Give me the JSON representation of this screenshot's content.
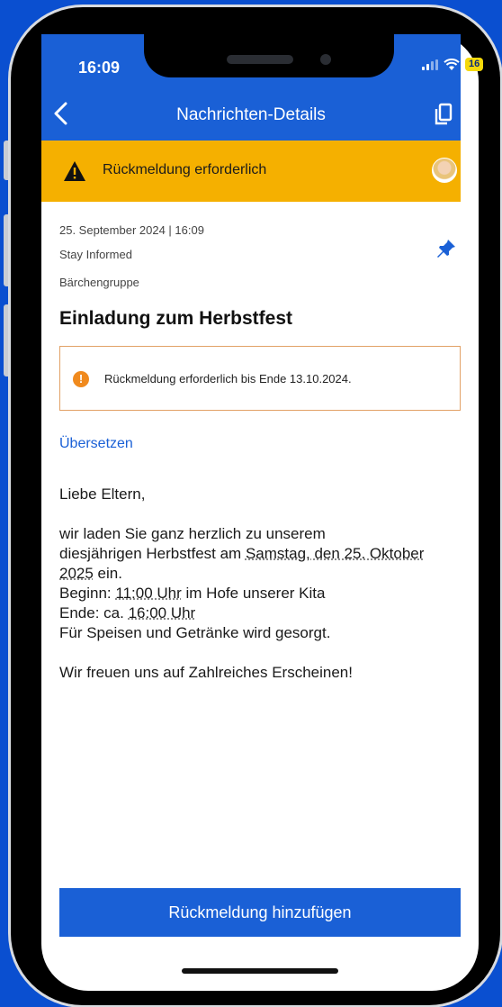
{
  "status_bar": {
    "time": "16:09",
    "battery": "16"
  },
  "header": {
    "title": "Nachrichten-Details"
  },
  "banner": {
    "label": "Rückmeldung erforderlich"
  },
  "message": {
    "date": "25. September 2024 | 16:09",
    "sender": "Stay Informed",
    "group": "Bärchengruppe",
    "title": "Einladung zum Herbstfest",
    "notice": "Rückmeldung erforderlich bis Ende 13.10.2024.",
    "translate_link": "Übersetzen",
    "greeting": "Liebe Eltern,",
    "p1_a": "wir laden Sie ganz herzlich zu unserem",
    "p1_b": "diesjährigen Herbstfest am ",
    "p1_date": "Samstag, den 25. Oktober 2025",
    "p1_c": " ein.",
    "p1_begin_label": "Beginn: ",
    "p1_begin_time": "11:00 Uhr",
    "p1_begin_rest": " im Hofe unserer Kita",
    "p1_end_label": "Ende: ca. ",
    "p1_end_time": "16:00 Uhr",
    "p1_food": "Für Speisen und Getränke wird gesorgt.",
    "closing": "Wir freuen uns auf Zahlreiches Erscheinen!"
  },
  "actions": {
    "add_feedback": "Rückmeldung hinzufügen"
  },
  "colors": {
    "brand": "#1a60d6",
    "banner": "#f5b000",
    "notice_border": "#e2a166",
    "notice_icon": "#f08a1e"
  }
}
